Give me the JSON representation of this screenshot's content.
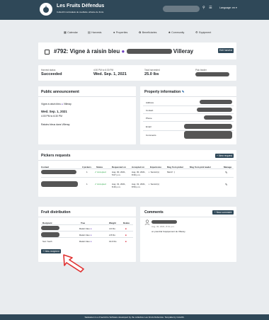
{
  "header": {
    "brand_title": "Les Fruits Défendus",
    "brand_subtitle": "Collectif montréalais de cueillette urbaine de fruits",
    "language": "Language: en ▾"
  },
  "nav": {
    "items": [
      {
        "icon": "calendar-icon",
        "glyph": "▦",
        "label": "Calendar"
      },
      {
        "icon": "harvest-icon",
        "glyph": "▤",
        "label": "Harvests"
      },
      {
        "icon": "property-icon",
        "glyph": "●",
        "label": "Properties"
      },
      {
        "icon": "beneficiaries-icon",
        "glyph": "✿",
        "label": "Beneficiaries"
      },
      {
        "icon": "community-icon",
        "glyph": "♣",
        "label": "Community"
      },
      {
        "icon": "equipment-icon",
        "glyph": "⚙",
        "label": "Equipment"
      }
    ]
  },
  "harvest": {
    "title": "#792: Vigne à raisin bleu",
    "city": "Villeray",
    "edit_label": "Edit harvest",
    "status_label": "Harvest status",
    "status_value": "Succeeded",
    "time_label": "4:00 PM to 6:30 PM",
    "date_value": "Wed. Sep. 1, 2021",
    "total_label": "Total harvested",
    "total_value": "25.0 lbs",
    "pick_leader_label": "Pick leader"
  },
  "announcement": {
    "title": "Public announcement",
    "line1": "Vigne à raisin bleu",
    "line1_suffix": "Villeray",
    "date": "Wed. Sep. 1, 2021",
    "time": "4:00 PM to 6:30 PM",
    "desc": "Raisins bleus dans Villeray"
  },
  "property": {
    "title": "Property information",
    "fields": [
      "Address",
      "Contact",
      "Phone",
      "Email",
      "Comments"
    ]
  },
  "pickers": {
    "title": "Pickers requests",
    "new_label": "+ New request",
    "headers": [
      "Contact",
      "# pickers",
      "Status",
      "Requested on",
      "Accepted on",
      "Experience",
      "Msg from picker",
      "Msg from pick leader",
      "Manage"
    ],
    "rows": [
      {
        "count": "1",
        "status": "✔ Accepted",
        "req1": "Aug. 30, 2021,",
        "req2": "5:07 p.m.",
        "acc1": "Aug. 30, 2021,",
        "acc2": "8:39 p.m.",
        "exp": "◐ Senior(s)",
        "msg": "Merci! :)"
      },
      {
        "count": "1",
        "status": "✔ Accepted",
        "req1": "Aug. 31, 2021,",
        "req2": "8:46 p.m.",
        "acc1": "Aug. 31, 2021,",
        "acc2": "8:59 p.m.",
        "exp": "◐ Senior(s)",
        "msg": ""
      }
    ]
  },
  "distribution": {
    "title": "Fruit distribution",
    "headers": [
      "Recipient",
      "Tree",
      "Weight",
      "Delete"
    ],
    "rows": [
      {
        "tree": "Raisin bleu",
        "weight": "4.0 lbs"
      },
      {
        "tree": "Raisin bleu",
        "weight": "2.8 lbs"
      },
      {
        "recipient": "Sun Youth",
        "tree": "Raisin bleu",
        "weight": "19.0 lbs"
      }
    ],
    "new_label": "+ New recipient"
  },
  "comments": {
    "title": "Comments",
    "new_label": "+ New comment",
    "date": "Aug. 30, 2021, 8:41 p.m.",
    "text": "on prendrai l'équipement de Villeray"
  },
  "footer": {
    "text": "Saskatoon is a Free/Libre Software developed by the collective Les Fruits Défendus. Template by Colorlib."
  }
}
